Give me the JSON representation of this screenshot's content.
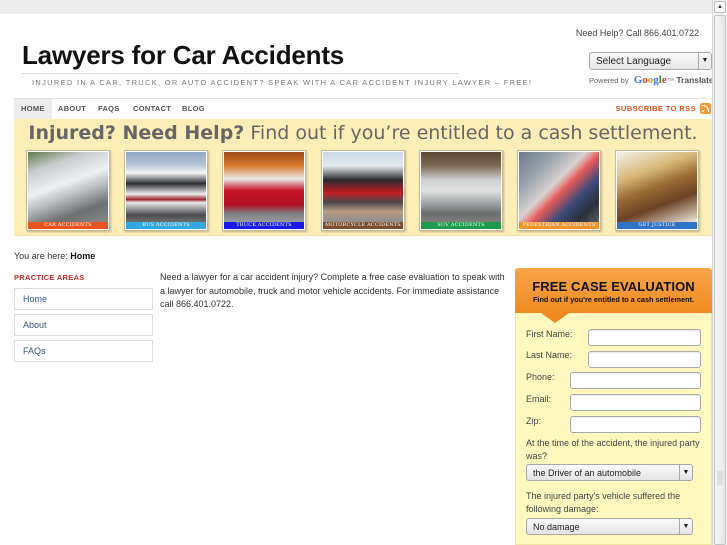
{
  "site": {
    "title": "Lawyers for Car Accidents",
    "tagline": "INJURED IN A CAR, TRUCK, OR AUTO ACCIDENT? SPEAK WITH A CAR ACCIDENT INJURY LAWYER – FREE!"
  },
  "header_right": {
    "need_help": "Need Help? Call 866.401.0722",
    "language_select": "Select Language",
    "powered_by": "Powered by",
    "google": [
      "G",
      "o",
      "o",
      "g",
      "l",
      "e"
    ],
    "translate": "Translate"
  },
  "nav": {
    "items": [
      {
        "label": "HOME",
        "active": true
      },
      {
        "label": "ABOUT"
      },
      {
        "label": "FAQS"
      },
      {
        "label": "CONTACT"
      },
      {
        "label": "BLOG"
      }
    ],
    "rss_label": "SUBSCRIBE TO RSS",
    "rss_icon": "rss-feed-icon"
  },
  "banner": {
    "headline_bold": "Injured? Need Help?",
    "headline_rest": " Find out if you’re entitled to a cash settlement.",
    "tiles": [
      {
        "label": "CAR ACCIDENTS",
        "color": "#e8531f"
      },
      {
        "label": "BUS ACCIDENTS",
        "color": "#32a8e0"
      },
      {
        "label": "TRUCK ACCIDENTS",
        "color": "#1a1ae6"
      },
      {
        "label": "MOTORCYCLE ACCIDENTS",
        "color": "#7a4e2c"
      },
      {
        "label": "SUV ACCIDENTS",
        "color": "#1d9a4c"
      },
      {
        "label": "PEDESTRIAN ACCIDENTS",
        "color": "#f0952c"
      },
      {
        "label": "GET JUSTICE",
        "color": "#2f73c6"
      }
    ]
  },
  "breadcrumb": {
    "prefix": "You are here:",
    "current": "Home"
  },
  "sidebar": {
    "heading": "PRACTICE AREAS",
    "items": [
      {
        "label": "Home"
      },
      {
        "label": "About"
      },
      {
        "label": "FAQs"
      }
    ]
  },
  "main": {
    "intro": "Need a lawyer for a car accident injury? Complete a free case evaluation to speak with a lawyer for automobile, truck and motor vehicle accidents.  For immediate assistance call 866.401.0722."
  },
  "evaluation": {
    "title": "FREE CASE EVALUATION",
    "subtitle": "Find out if you're entitled to a cash settlement.",
    "fields": {
      "first_name": {
        "label": "First Name:",
        "value": ""
      },
      "last_name": {
        "label": "Last Name:",
        "value": ""
      },
      "phone": {
        "label": "Phone:",
        "value": ""
      },
      "email": {
        "label": "Email:",
        "value": ""
      },
      "zip": {
        "label": "Zip:",
        "value": ""
      }
    },
    "q1": {
      "text": "At the time of the accident, the injured party was?",
      "selected": "the Driver of an automobile"
    },
    "q2": {
      "text": "The injured party's vehicle suffered the following damage:",
      "selected": "No damage"
    }
  },
  "colors": {
    "accent_orange": "#f08a20",
    "sidebar_heading": "#c42c2c",
    "rss": "#d9541c",
    "banner_bg": "#fdeeb8",
    "form_bg": "#fff9c0"
  }
}
